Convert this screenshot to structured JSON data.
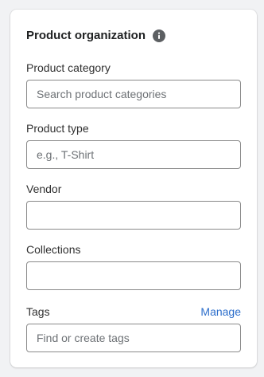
{
  "card": {
    "title": "Product organization",
    "info_icon": "info-circle-icon"
  },
  "fields": {
    "category": {
      "label": "Product category",
      "placeholder": "Search product categories",
      "value": ""
    },
    "type": {
      "label": "Product type",
      "placeholder": "e.g., T-Shirt",
      "value": ""
    },
    "vendor": {
      "label": "Vendor",
      "placeholder": "",
      "value": ""
    },
    "collections": {
      "label": "Collections",
      "placeholder": "",
      "value": ""
    },
    "tags": {
      "label": "Tags",
      "action": "Manage",
      "placeholder": "Find or create tags",
      "value": ""
    }
  },
  "colors": {
    "link": "#2c6ecb",
    "border": "#8a8a8a",
    "background": "#f1f2f4"
  }
}
